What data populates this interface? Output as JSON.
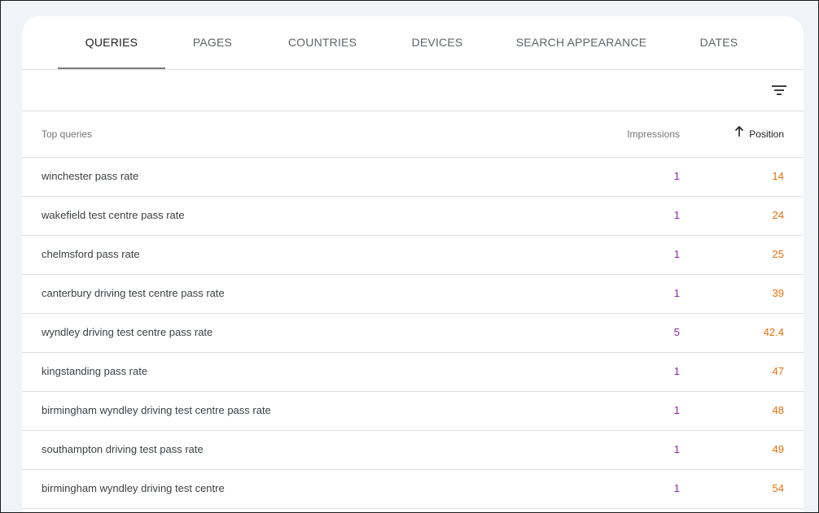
{
  "tabs": [
    {
      "label": "QUERIES",
      "active": true
    },
    {
      "label": "PAGES",
      "active": false
    },
    {
      "label": "COUNTRIES",
      "active": false
    },
    {
      "label": "DEVICES",
      "active": false
    },
    {
      "label": "SEARCH APPEARANCE",
      "active": false
    },
    {
      "label": "DATES",
      "active": false
    }
  ],
  "filter": {
    "icon": "filter-list-icon"
  },
  "table": {
    "headers": {
      "query": "Top queries",
      "impressions": "Impressions",
      "position": "Position",
      "sort_icon": "arrow-up-icon"
    },
    "rows": [
      {
        "query": "winchester pass rate",
        "impressions": "1",
        "position": "14"
      },
      {
        "query": "wakefield test centre pass rate",
        "impressions": "1",
        "position": "24"
      },
      {
        "query": "chelmsford pass rate",
        "impressions": "1",
        "position": "25"
      },
      {
        "query": "canterbury driving test centre pass rate",
        "impressions": "1",
        "position": "39"
      },
      {
        "query": "wyndley driving test centre pass rate",
        "impressions": "5",
        "position": "42.4"
      },
      {
        "query": "kingstanding pass rate",
        "impressions": "1",
        "position": "47"
      },
      {
        "query": "birmingham wyndley driving test centre pass rate",
        "impressions": "1",
        "position": "48"
      },
      {
        "query": "southampton driving test pass rate",
        "impressions": "1",
        "position": "49"
      },
      {
        "query": "birmingham wyndley driving test centre",
        "impressions": "1",
        "position": "54"
      }
    ]
  },
  "colors": {
    "impressions": "#8e24aa",
    "position": "#e8710a",
    "active_tab_underline": "#7a7a7a"
  }
}
